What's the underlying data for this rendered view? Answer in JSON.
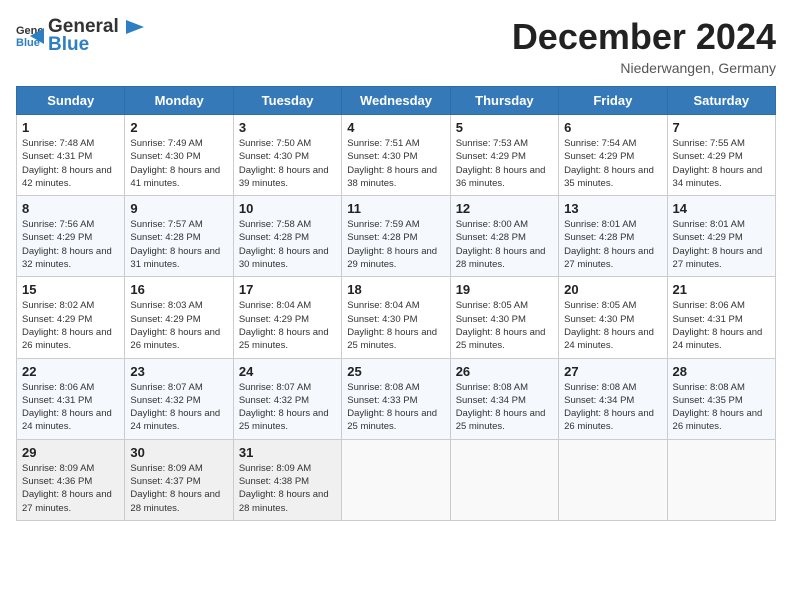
{
  "header": {
    "logo_general": "General",
    "logo_blue": "Blue",
    "month": "December 2024",
    "location": "Niederwangen, Germany"
  },
  "weekdays": [
    "Sunday",
    "Monday",
    "Tuesday",
    "Wednesday",
    "Thursday",
    "Friday",
    "Saturday"
  ],
  "weeks": [
    [
      {
        "day": "1",
        "sunrise": "7:48 AM",
        "sunset": "4:31 PM",
        "daylight": "8 hours and 42 minutes."
      },
      {
        "day": "2",
        "sunrise": "7:49 AM",
        "sunset": "4:30 PM",
        "daylight": "8 hours and 41 minutes."
      },
      {
        "day": "3",
        "sunrise": "7:50 AM",
        "sunset": "4:30 PM",
        "daylight": "8 hours and 39 minutes."
      },
      {
        "day": "4",
        "sunrise": "7:51 AM",
        "sunset": "4:30 PM",
        "daylight": "8 hours and 38 minutes."
      },
      {
        "day": "5",
        "sunrise": "7:53 AM",
        "sunset": "4:29 PM",
        "daylight": "8 hours and 36 minutes."
      },
      {
        "day": "6",
        "sunrise": "7:54 AM",
        "sunset": "4:29 PM",
        "daylight": "8 hours and 35 minutes."
      },
      {
        "day": "7",
        "sunrise": "7:55 AM",
        "sunset": "4:29 PM",
        "daylight": "8 hours and 34 minutes."
      }
    ],
    [
      {
        "day": "8",
        "sunrise": "7:56 AM",
        "sunset": "4:29 PM",
        "daylight": "8 hours and 32 minutes."
      },
      {
        "day": "9",
        "sunrise": "7:57 AM",
        "sunset": "4:28 PM",
        "daylight": "8 hours and 31 minutes."
      },
      {
        "day": "10",
        "sunrise": "7:58 AM",
        "sunset": "4:28 PM",
        "daylight": "8 hours and 30 minutes."
      },
      {
        "day": "11",
        "sunrise": "7:59 AM",
        "sunset": "4:28 PM",
        "daylight": "8 hours and 29 minutes."
      },
      {
        "day": "12",
        "sunrise": "8:00 AM",
        "sunset": "4:28 PM",
        "daylight": "8 hours and 28 minutes."
      },
      {
        "day": "13",
        "sunrise": "8:01 AM",
        "sunset": "4:28 PM",
        "daylight": "8 hours and 27 minutes."
      },
      {
        "day": "14",
        "sunrise": "8:01 AM",
        "sunset": "4:29 PM",
        "daylight": "8 hours and 27 minutes."
      }
    ],
    [
      {
        "day": "15",
        "sunrise": "8:02 AM",
        "sunset": "4:29 PM",
        "daylight": "8 hours and 26 minutes."
      },
      {
        "day": "16",
        "sunrise": "8:03 AM",
        "sunset": "4:29 PM",
        "daylight": "8 hours and 26 minutes."
      },
      {
        "day": "17",
        "sunrise": "8:04 AM",
        "sunset": "4:29 PM",
        "daylight": "8 hours and 25 minutes."
      },
      {
        "day": "18",
        "sunrise": "8:04 AM",
        "sunset": "4:30 PM",
        "daylight": "8 hours and 25 minutes."
      },
      {
        "day": "19",
        "sunrise": "8:05 AM",
        "sunset": "4:30 PM",
        "daylight": "8 hours and 25 minutes."
      },
      {
        "day": "20",
        "sunrise": "8:05 AM",
        "sunset": "4:30 PM",
        "daylight": "8 hours and 24 minutes."
      },
      {
        "day": "21",
        "sunrise": "8:06 AM",
        "sunset": "4:31 PM",
        "daylight": "8 hours and 24 minutes."
      }
    ],
    [
      {
        "day": "22",
        "sunrise": "8:06 AM",
        "sunset": "4:31 PM",
        "daylight": "8 hours and 24 minutes."
      },
      {
        "day": "23",
        "sunrise": "8:07 AM",
        "sunset": "4:32 PM",
        "daylight": "8 hours and 24 minutes."
      },
      {
        "day": "24",
        "sunrise": "8:07 AM",
        "sunset": "4:32 PM",
        "daylight": "8 hours and 25 minutes."
      },
      {
        "day": "25",
        "sunrise": "8:08 AM",
        "sunset": "4:33 PM",
        "daylight": "8 hours and 25 minutes."
      },
      {
        "day": "26",
        "sunrise": "8:08 AM",
        "sunset": "4:34 PM",
        "daylight": "8 hours and 25 minutes."
      },
      {
        "day": "27",
        "sunrise": "8:08 AM",
        "sunset": "4:34 PM",
        "daylight": "8 hours and 26 minutes."
      },
      {
        "day": "28",
        "sunrise": "8:08 AM",
        "sunset": "4:35 PM",
        "daylight": "8 hours and 26 minutes."
      }
    ],
    [
      {
        "day": "29",
        "sunrise": "8:09 AM",
        "sunset": "4:36 PM",
        "daylight": "8 hours and 27 minutes."
      },
      {
        "day": "30",
        "sunrise": "8:09 AM",
        "sunset": "4:37 PM",
        "daylight": "8 hours and 28 minutes."
      },
      {
        "day": "31",
        "sunrise": "8:09 AM",
        "sunset": "4:38 PM",
        "daylight": "8 hours and 28 minutes."
      },
      null,
      null,
      null,
      null
    ]
  ]
}
